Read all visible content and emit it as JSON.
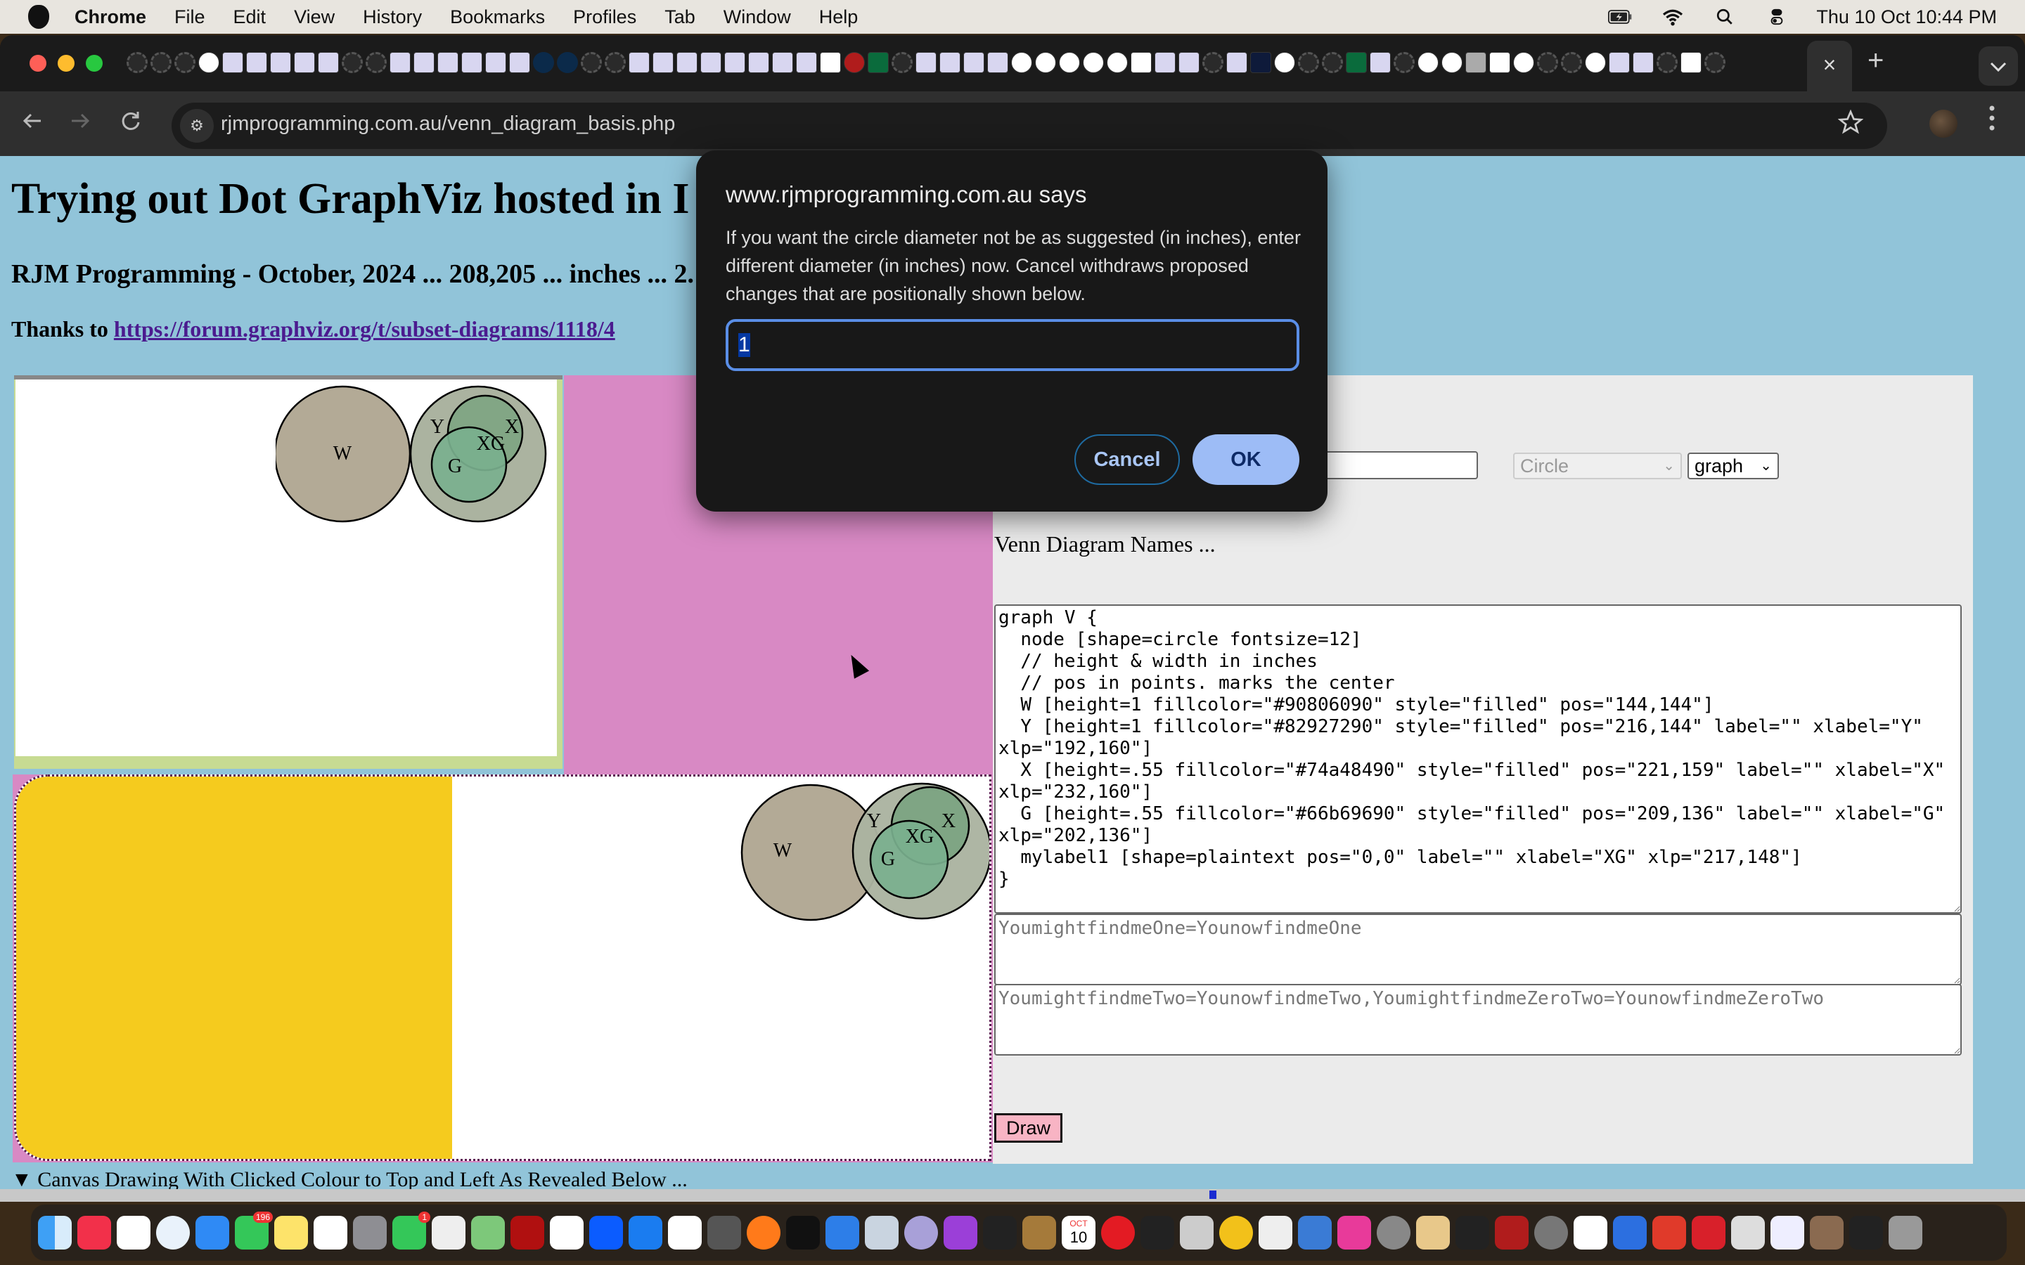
{
  "menubar": {
    "app": "Chrome",
    "items": [
      "File",
      "Edit",
      "View",
      "History",
      "Bookmarks",
      "Profiles",
      "Tab",
      "Window",
      "Help"
    ],
    "clock": "Thu 10 Oct  10:44 PM"
  },
  "browser": {
    "url": "rjmprogramming.com.au/venn_diagram_basis.php",
    "active_tab_close": "×",
    "new_tab": "+",
    "tab_dropdown": "⌄"
  },
  "page": {
    "title": "Trying out Dot GraphViz hosted in I",
    "subtitle": "RJM Programming - October, 2024 ... 208,205 ... inches ... 2.1",
    "thanks_prefix": "Thanks to ",
    "thanks_link": "https://forum.graphviz.org/t/subset-diagrams/1118/4",
    "details_summary": "▼ Canvas Drawing With Clicked Colour to Top and Left As Revealed Below ...",
    "venn": {
      "labels": [
        "W",
        "Y",
        "X",
        "XG",
        "G"
      ],
      "colors": {
        "W": "#b3aa96",
        "Y": "#abb3a0",
        "X": "#7fa584",
        "G": "#79b08e"
      }
    }
  },
  "form": {
    "shape_select": "Circle",
    "graph_select": "graph",
    "venn_names_label": "Venn Diagram Names ...",
    "code": "graph V {\n  node [shape=circle fontsize=12]\n  // height & width in inches\n  // pos in points. marks the center\n  W [height=1 fillcolor=\"#90806090\" style=\"filled\" pos=\"144,144\"]\n  Y [height=1 fillcolor=\"#82927290\" style=\"filled\" pos=\"216,144\" label=\"\" xlabel=\"Y\" xlp=\"192,160\"]\n  X [height=.55 fillcolor=\"#74a48490\" style=\"filled\" pos=\"221,159\" label=\"\" xlabel=\"X\"  xlp=\"232,160\"]\n  G [height=.55 fillcolor=\"#66b69690\" style=\"filled\" pos=\"209,136\" label=\"\" xlabel=\"G\"  xlp=\"202,136\"]\n  mylabel1 [shape=plaintext pos=\"0,0\" label=\"\" xlabel=\"XG\" xlp=\"217,148\"]\n}",
    "placeholder_one": "YoumightfindmeOne=YounowfindmeOne",
    "placeholder_two": "YoumightfindmeTwo=YounowfindmeTwo,YoumightfindmeZeroTwo=YounowfindmeZeroTwo",
    "draw_label": "Draw"
  },
  "dialog": {
    "title": "www.rjmprogramming.com.au says",
    "message": "If you want the circle diameter not be as suggested (in inches), enter different diameter (in inches) now.  Cancel withdraws proposed changes that are positionally shown below.",
    "input_value": "1",
    "cancel_label": "Cancel",
    "ok_label": "OK"
  },
  "dock": {
    "calendar_month": "OCT",
    "calendar_day": "10",
    "messages_badge": "196",
    "facetime_badge": "1"
  }
}
